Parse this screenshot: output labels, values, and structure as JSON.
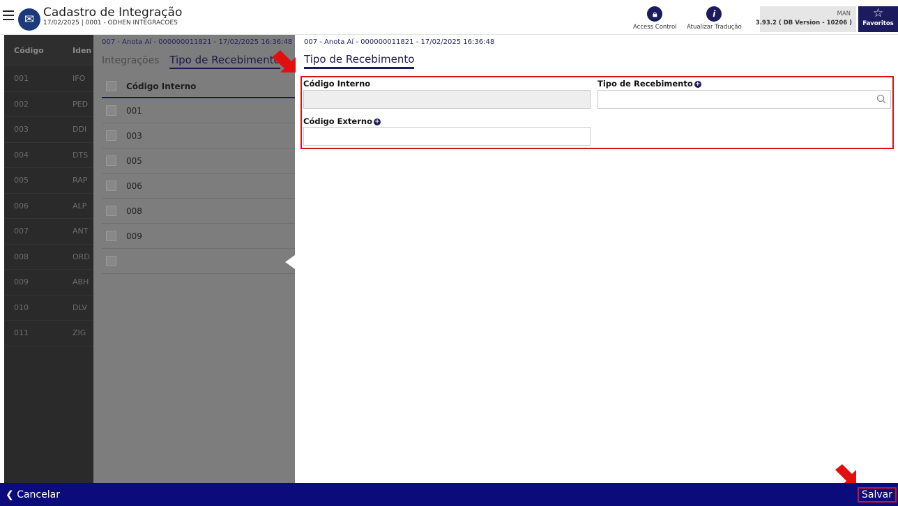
{
  "header": {
    "title": "Cadastro de Integração",
    "subtitle": "17/02/2025 | 0001 - ODHEN INTEGRACOES",
    "access_control_label": "Access Control",
    "translate_label": "Atualizar Tradução",
    "version_user": "MAN",
    "version_text": "3.93.2 ( DB Version - 10206 )",
    "favorites_label": "Favoritos"
  },
  "left_grid": {
    "columns": [
      "Código",
      "Iden"
    ],
    "rows": [
      {
        "code": "001",
        "id": "IFO"
      },
      {
        "code": "002",
        "id": "PED"
      },
      {
        "code": "003",
        "id": "DDI"
      },
      {
        "code": "004",
        "id": "DTS"
      },
      {
        "code": "005",
        "id": "RAP"
      },
      {
        "code": "006",
        "id": "ALP"
      },
      {
        "code": "007",
        "id": "ANT"
      },
      {
        "code": "008",
        "id": "ORD"
      },
      {
        "code": "009",
        "id": "ABH"
      },
      {
        "code": "010",
        "id": "DLV"
      },
      {
        "code": "011",
        "id": "ZIG"
      }
    ]
  },
  "middle_panel": {
    "breadcrumb": "007 - Anota Aí - 000000011821 - 17/02/2025 16:36:48",
    "tabs": [
      "Integrações",
      "Tipo de Recebimento"
    ],
    "column_header": "Código Interno",
    "rows": [
      "001",
      "003",
      "005",
      "006",
      "008",
      "009",
      ""
    ]
  },
  "right_pane": {
    "breadcrumb": "007 - Anota Aí - 000000011821 - 17/02/2025 16:36:48",
    "tab": "Tipo de Recebimento",
    "fields": {
      "codigo_interno_label": "Código Interno",
      "codigo_interno_value": "",
      "tipo_recebimento_label": "Tipo de Recebimento",
      "tipo_recebimento_value": "",
      "codigo_externo_label": "Código Externo",
      "codigo_externo_value": ""
    }
  },
  "footer": {
    "cancel_label": "Cancelar",
    "save_label": "Salvar"
  },
  "icons": {
    "menu": "hamburger-icon",
    "logo": "chart-icon",
    "access_control": "lock-icon",
    "translate": "info-icon",
    "favorites": "star-icon",
    "search": "search-icon",
    "plus": "plus-circle-icon",
    "back": "chevron-left-icon"
  },
  "colors": {
    "primary": "#1b1b5e",
    "footer": "#0b0b7c",
    "highlight": "#d8111b"
  }
}
